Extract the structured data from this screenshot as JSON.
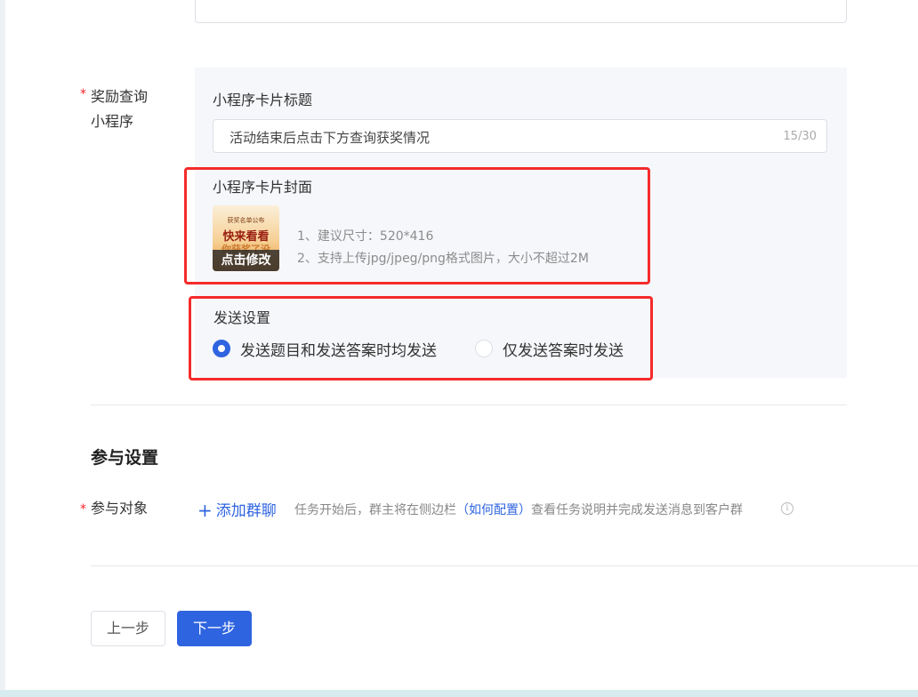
{
  "reward": {
    "label_line1": "奖励查询",
    "label_line2": "小程序",
    "card_title_label": "小程序卡片标题",
    "card_title_value": "活动结束后点击下方查询获奖情况",
    "card_title_count": "15/30",
    "cover_label": "小程序卡片封面",
    "cover_image_text": {
      "small": "获奖名单公布",
      "big": "快来看看",
      "sub": "你获奖了没"
    },
    "cover_edit": "点击修改",
    "tips": [
      "1、建议尺寸：520*416",
      "2、支持上传jpg/jpeg/png格式图片，大小不超过2M"
    ]
  },
  "send_settings": {
    "label": "发送设置",
    "options": [
      {
        "label": "发送题目和发送答案时均发送",
        "selected": true
      },
      {
        "label": "仅发送答案时发送",
        "selected": false
      }
    ]
  },
  "participation": {
    "section_title": "参与设置",
    "target_label": "参与对象",
    "add_group": "添加群聊",
    "desc_before": "任务开始后，群主将在侧边栏",
    "desc_link": "（如何配置）",
    "desc_after": "查看任务说明并完成发送消息到客户群"
  },
  "footer": {
    "prev": "上一步",
    "next": "下一步"
  },
  "colors": {
    "primary": "#2f64e0",
    "required": "#f5222d",
    "highlight": "#f52b2b"
  }
}
